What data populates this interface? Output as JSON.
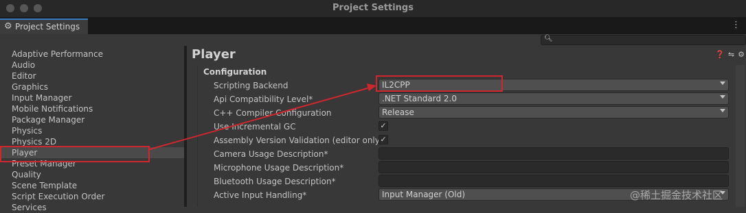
{
  "window": {
    "title": "Project Settings"
  },
  "tab": {
    "icon": "gear-icon",
    "label": "Project Settings"
  },
  "search": {
    "placeholder": ""
  },
  "sidebar": {
    "items": [
      {
        "label": "Adaptive Performance"
      },
      {
        "label": "Audio"
      },
      {
        "label": "Editor"
      },
      {
        "label": "Graphics"
      },
      {
        "label": "Input Manager"
      },
      {
        "label": "Mobile Notifications"
      },
      {
        "label": "Package Manager"
      },
      {
        "label": "Physics"
      },
      {
        "label": "Physics 2D"
      },
      {
        "label": "Player"
      },
      {
        "label": "Preset Manager"
      },
      {
        "label": "Quality"
      },
      {
        "label": "Scene Template"
      },
      {
        "label": "Script Execution Order"
      },
      {
        "label": "Services"
      }
    ],
    "selected": "Player"
  },
  "main": {
    "title": "Player",
    "section": "Configuration",
    "rows": [
      {
        "label": "Scripting Backend",
        "type": "dropdown",
        "value": "IL2CPP"
      },
      {
        "label": "Api Compatibility Level*",
        "type": "dropdown",
        "value": ".NET Standard 2.0"
      },
      {
        "label": "C++ Compiler Configuration",
        "type": "dropdown",
        "value": "Release"
      },
      {
        "label": "Use Incremental GC",
        "type": "checkbox",
        "checked": true
      },
      {
        "label": "Assembly Version Validation (editor only)",
        "type": "checkbox",
        "checked": true
      },
      {
        "label": "Camera Usage Description*",
        "type": "text",
        "value": ""
      },
      {
        "label": "Microphone Usage Description*",
        "type": "text",
        "value": ""
      },
      {
        "label": "Bluetooth Usage Description*",
        "type": "text",
        "value": ""
      },
      {
        "label": "Active Input Handling*",
        "type": "dropdown",
        "value": "Input Manager (Old)"
      }
    ]
  },
  "annotation": {
    "color": "#d0262d"
  },
  "watermark": "@稀土掘金技术社区"
}
